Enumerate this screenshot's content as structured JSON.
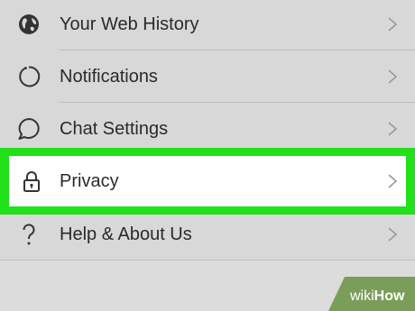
{
  "settings": {
    "items": [
      {
        "label": "Your Web History",
        "icon": "globe-icon"
      },
      {
        "label": "Notifications",
        "icon": "circle-arrow-icon"
      },
      {
        "label": "Chat Settings",
        "icon": "chat-bubble-icon"
      },
      {
        "label": "Privacy",
        "icon": "lock-icon"
      },
      {
        "label": "Help & About Us",
        "icon": "question-icon"
      }
    ]
  },
  "watermark": {
    "prefix": "wiki",
    "suffix": "How"
  },
  "colors": {
    "highlight": "#22e01a",
    "background": "#d8d8d8",
    "selected_row": "#ffffff"
  }
}
